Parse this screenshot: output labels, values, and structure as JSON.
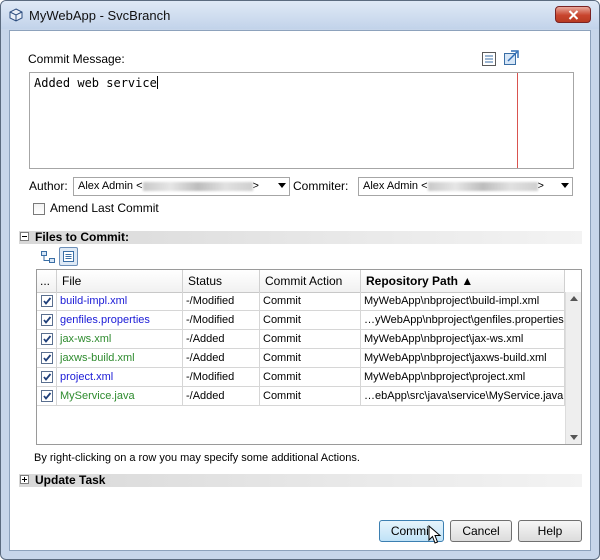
{
  "window": {
    "title": "MyWebApp - SvcBranch"
  },
  "commit_message": {
    "label": "Commit Message:",
    "value": "Added web service"
  },
  "author": {
    "label": "Author:",
    "value_prefix": "Alex Admin <",
    "value_suffix": ">"
  },
  "committer": {
    "label": "Commiter:",
    "value_prefix": "Alex Admin <",
    "value_suffix": ">"
  },
  "amend": {
    "label": "Amend Last Commit",
    "checked": false
  },
  "files_section": {
    "title": "Files to Commit:"
  },
  "table": {
    "columns": [
      "...",
      "File",
      "Status",
      "Commit Action",
      "Repository Path ▲"
    ],
    "rows": [
      {
        "file": "build-impl.xml",
        "status": "-/Modified",
        "action": "Commit",
        "path": "MyWebApp\\nbproject\\build-impl.xml",
        "color": "#1a1ad6"
      },
      {
        "file": "genfiles.properties",
        "status": "-/Modified",
        "action": "Commit",
        "path": "…yWebApp\\nbproject\\genfiles.properties",
        "color": "#1a1ad6"
      },
      {
        "file": "jax-ws.xml",
        "status": "-/Added",
        "action": "Commit",
        "path": "MyWebApp\\nbproject\\jax-ws.xml",
        "color": "#2e8b2e"
      },
      {
        "file": "jaxws-build.xml",
        "status": "-/Added",
        "action": "Commit",
        "path": "MyWebApp\\nbproject\\jaxws-build.xml",
        "color": "#2e8b2e"
      },
      {
        "file": "project.xml",
        "status": "-/Modified",
        "action": "Commit",
        "path": "MyWebApp\\nbproject\\project.xml",
        "color": "#1a1ad6"
      },
      {
        "file": "MyService.java",
        "status": "-/Added",
        "action": "Commit",
        "path": "…ebApp\\src\\java\\service\\MyService.java",
        "color": "#2e8b2e"
      }
    ]
  },
  "hint": "By right-clicking on a row you may specify some additional Actions.",
  "update_task": {
    "title": "Update Task"
  },
  "buttons": {
    "commit": "Commit",
    "cancel": "Cancel",
    "help": "Help"
  }
}
